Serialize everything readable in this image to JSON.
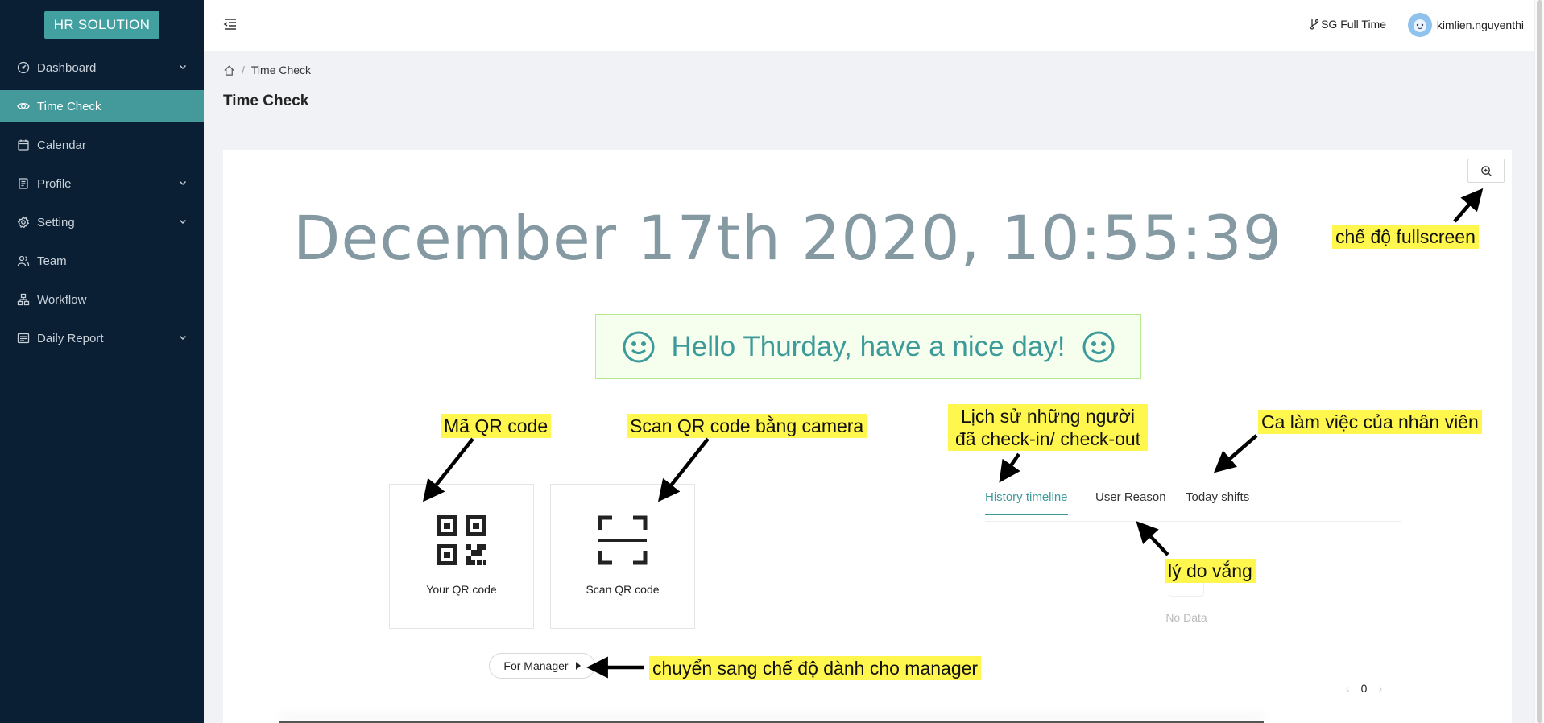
{
  "app": {
    "logo": "HR SOLUTION"
  },
  "sidebar": {
    "items": [
      {
        "label": "Dashboard",
        "icon": "dashboard-icon",
        "has_submenu": true
      },
      {
        "label": "Time Check",
        "icon": "eye-icon",
        "active": true
      },
      {
        "label": "Calendar",
        "icon": "calendar-icon"
      },
      {
        "label": "Profile",
        "icon": "profile-icon",
        "has_submenu": true
      },
      {
        "label": "Setting",
        "icon": "gear-icon",
        "has_submenu": true
      },
      {
        "label": "Team",
        "icon": "team-icon"
      },
      {
        "label": "Workflow",
        "icon": "workflow-icon"
      },
      {
        "label": "Daily Report",
        "icon": "report-icon",
        "has_submenu": true
      }
    ]
  },
  "header": {
    "branch": "SG Full Time",
    "username": "kimlien.nguyenthi"
  },
  "breadcrumb": {
    "current": "Time Check"
  },
  "page": {
    "title": "Time Check"
  },
  "clock": {
    "datetime": "December 17th 2020, 10:55:39"
  },
  "greeting": {
    "text": "Hello Thurday, have a nice day!"
  },
  "qr": {
    "your_label": "Your QR code",
    "scan_label": "Scan QR code"
  },
  "manager_button": {
    "label": "For Manager"
  },
  "tabs": [
    {
      "label": "History timeline",
      "active": true
    },
    {
      "label": "User Reason"
    },
    {
      "label": "Today shifts"
    }
  ],
  "empty": {
    "text": "No Data"
  },
  "pagination": {
    "current": "0"
  },
  "annotations": {
    "fullscreen": "chế độ fullscreen",
    "qr_code": "Mã QR code",
    "scan_camera": "Scan QR code bằng camera",
    "history_line1": "Lịch sử những người",
    "history_line2": "đã check-in/ check-out",
    "shifts": "Ca làm việc của nhân viên",
    "reason": "lý do vắng",
    "manager": "chuyển sang chế độ dành cho manager"
  },
  "colors": {
    "sidebar_bg": "#0a1f33",
    "accent": "#449a9b",
    "clock": "#8499a2",
    "highlight": "#fff74d"
  }
}
